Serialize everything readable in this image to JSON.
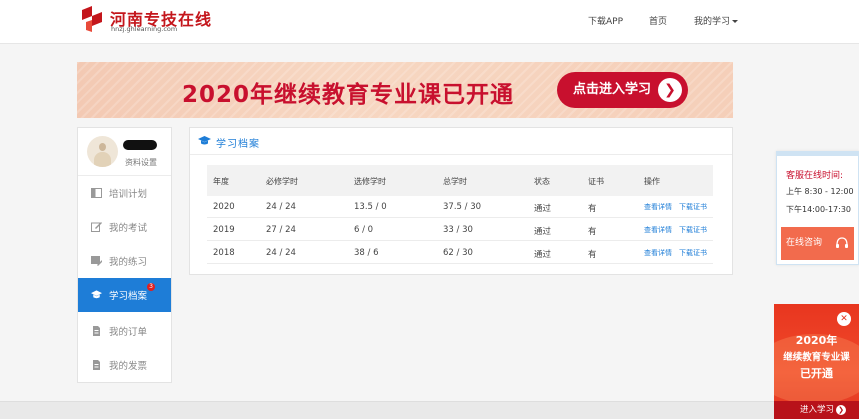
{
  "header": {
    "logo_title": "河南专技在线",
    "logo_subtitle": "hnzj.ghlearning.com",
    "nav": {
      "download_app": "下载APP",
      "home": "首页",
      "my_learning": "我的学习"
    }
  },
  "banner": {
    "headline": "2020年继续教育专业课已开通",
    "button_label": "点击进入学习",
    "button_arrow": "❯"
  },
  "sidebar": {
    "profile_link": "资料设置",
    "items": [
      {
        "label": "培训计划",
        "icon": "book-icon"
      },
      {
        "label": "我的考试",
        "icon": "edit-icon"
      },
      {
        "label": "我的练习",
        "icon": "pencil-note-icon"
      },
      {
        "label": "学习档案",
        "icon": "graduation-cap-icon",
        "badge": "3",
        "active": true
      },
      {
        "label": "我的订单",
        "icon": "document-icon"
      },
      {
        "label": "我的发票",
        "icon": "document-icon"
      }
    ]
  },
  "records": {
    "title": "学习档案",
    "columns": {
      "year": "年度",
      "required": "必修学时",
      "elective": "选修学时",
      "total": "总学时",
      "status": "状态",
      "certificate": "证书",
      "ops": "操作"
    },
    "rows": [
      {
        "year": "2020",
        "required": "24 / 24",
        "elective": "13.5 / 0",
        "total": "37.5 / 30",
        "status": "通过",
        "certificate": "有",
        "view": "查看详情",
        "download": "下载证书"
      },
      {
        "year": "2019",
        "required": "27 / 24",
        "elective": "6 / 0",
        "total": "33 / 30",
        "status": "通过",
        "certificate": "有",
        "view": "查看详情",
        "download": "下载证书"
      },
      {
        "year": "2018",
        "required": "24 / 24",
        "elective": "38 / 6",
        "total": "62 / 30",
        "status": "通过",
        "certificate": "有",
        "view": "查看详情",
        "download": "下载证书"
      }
    ]
  },
  "service": {
    "title": "客服在线时间:",
    "morning": "上午 8:30 - 12:00",
    "afternoon": "下午14:00-17:30",
    "button_label": "在线咨询"
  },
  "promo": {
    "close": "✕",
    "line1": "2020年",
    "line2": "继续教育专业课",
    "line3": "已开通",
    "button_label": "进入学习",
    "button_arrow": "❯"
  },
  "colors": {
    "accent": "#1e7dd7",
    "brand_red": "#c8102e",
    "promo_red": "#e8361f"
  }
}
